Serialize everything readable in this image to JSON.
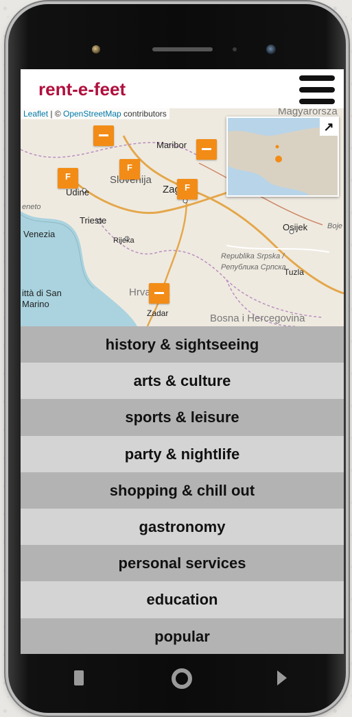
{
  "app": {
    "title": "rent-e-feet"
  },
  "map": {
    "attribution": {
      "leaflet": "Leaflet",
      "separator": " | © ",
      "osm": "OpenStreetMap",
      "contributors": " contributors"
    },
    "places": [
      "Magyarorsza",
      "Maribor",
      "Slovenija",
      "Zagreb",
      "Udine",
      "Trieste",
      "Venezia",
      "Rijeka",
      "Osijek",
      "Republika Srpska /",
      "Република Српска",
      "Tuzla",
      "Hrvatska",
      "Zadar",
      "ittà di San Marino",
      "Bosna i Hercegovina",
      "eneto",
      "Boje"
    ],
    "minimap_toggle_icon": "expand-arrow-icon",
    "marker_color": "#f28c16"
  },
  "menu": {
    "items": [
      "history & sightseeing",
      "arts & culture",
      "sports & leisure",
      "party & nightlife",
      "shopping & chill out",
      "gastronomy",
      "personal services",
      "education",
      "popular"
    ]
  },
  "colors": {
    "brand": "#b0103e",
    "menu_dark": "#b3b3b3",
    "menu_light": "#d4d4d4"
  }
}
